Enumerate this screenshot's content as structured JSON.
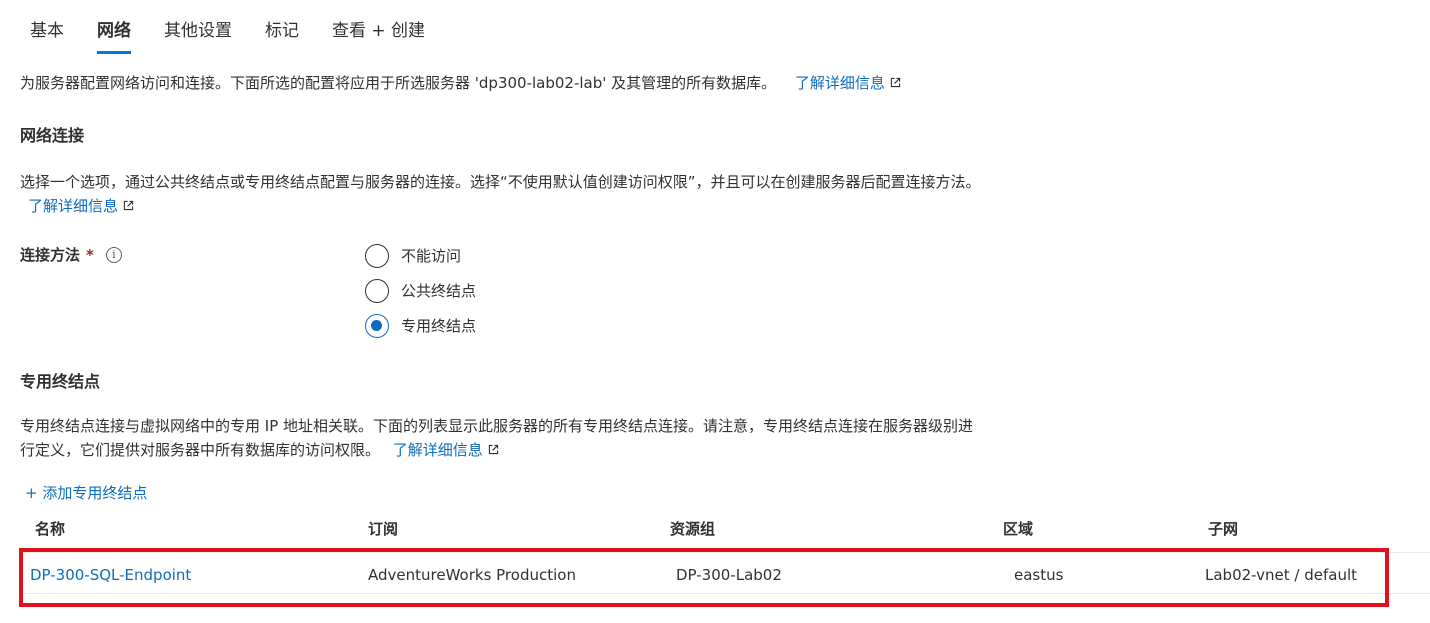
{
  "tabs": [
    {
      "label": "基本",
      "active": false
    },
    {
      "label": "网络",
      "active": true
    },
    {
      "label": "其他设置",
      "active": false
    },
    {
      "label": "标记",
      "active": false
    },
    {
      "label": "查看 + 创建",
      "active": false
    }
  ],
  "intro": {
    "text": "为服务器配置网络访问和连接。下面所选的配置将应用于所选服务器 'dp300-lab02-lab' 及其管理的所有数据库。",
    "link": "了解详细信息"
  },
  "network": {
    "title": "网络连接",
    "desc": "选择一个选项，通过公共终结点或专用终结点配置与服务器的连接。选择“不使用默认值创建访问权限”，并且可以在创建服务器后配置连接方法。",
    "link": "了解详细信息",
    "method_label": "连接方法",
    "required_mark": "*",
    "info_icon": "i",
    "options": [
      {
        "label": "不能访问",
        "checked": false
      },
      {
        "label": "公共终结点",
        "checked": false
      },
      {
        "label": "专用终结点",
        "checked": true
      }
    ]
  },
  "private_endpoint": {
    "title": "专用终结点",
    "desc": "专用终结点连接与虚拟网络中的专用 IP 地址相关联。下面的列表显示此服务器的所有专用终结点连接。请注意，专用终结点连接在服务器级别进行定义，它们提供对服务器中所有数据库的访问权限。",
    "link": "了解详细信息",
    "add_label": "+ 添加专用终结点"
  },
  "table": {
    "columns": [
      "名称",
      "订阅",
      "资源组",
      "区域",
      "子网"
    ],
    "rows": [
      {
        "name": "DP-300-SQL-Endpoint",
        "subscription": "AdventureWorks Production",
        "resource_group": "DP-300-Lab02",
        "region": "eastus",
        "subnet": "Lab02-vnet / default"
      }
    ]
  },
  "colors": {
    "accent": "#0078d4",
    "link": "#0f6cbd",
    "highlight": "#e0101c"
  }
}
